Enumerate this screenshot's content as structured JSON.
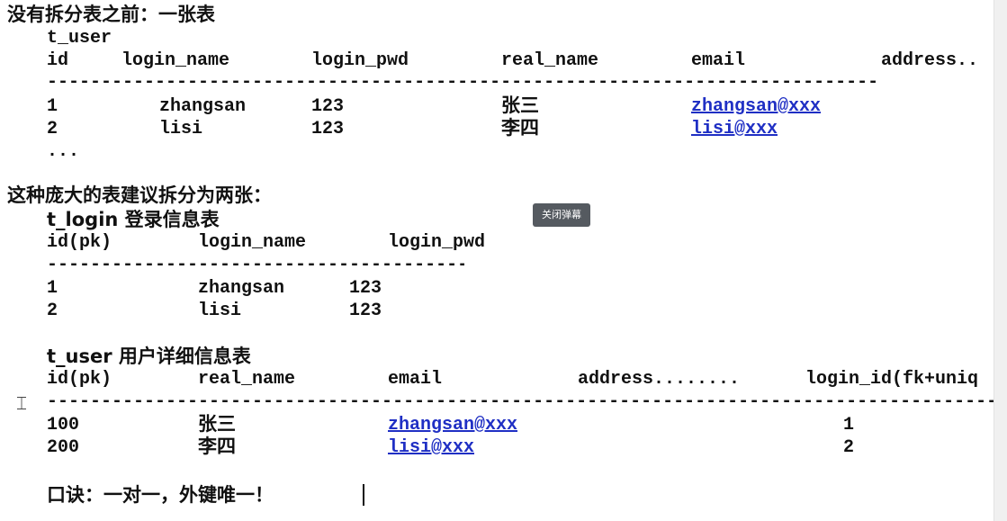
{
  "heading1": "没有拆分表之前：一张表",
  "table1": {
    "name": "t_user",
    "headers": [
      "id",
      "login_name",
      "login_pwd",
      "real_name",
      "email",
      "address.."
    ],
    "dashes": "-----------------------------------------------------------------------------",
    "rows": [
      [
        "1",
        "zhangsan",
        "123",
        "张三",
        "zhangsan@xxx"
      ],
      [
        "2",
        "lisi",
        "123",
        "李四",
        "lisi@xxx"
      ]
    ],
    "ellipsis": "..."
  },
  "heading2": "这种庞大的表建议拆分为两张：",
  "badge": "关闭弹幕",
  "table2": {
    "name": "t_login 登录信息表",
    "headers": [
      "id(pk)",
      "login_name",
      "login_pwd"
    ],
    "dashes": "----------------------------------------------",
    "rows": [
      [
        "1",
        "zhangsan",
        "123"
      ],
      [
        "2",
        "lisi",
        "123"
      ]
    ]
  },
  "table3": {
    "name": "t_user 用户详细信息表",
    "headers": [
      "id(pk)",
      "real_name",
      "email",
      "address........",
      "login_id(fk+uniq"
    ],
    "dashes": "------------------------------------------------------------------------------------------------------",
    "rows": [
      [
        "100",
        "张三",
        "zhangsan@xxx",
        "1"
      ],
      [
        "200",
        "李四",
        "lisi@xxx",
        "2"
      ]
    ]
  },
  "slogan": "口诀：一对一，外键唯一！",
  "cursor_icon": "text-cursor-icon"
}
